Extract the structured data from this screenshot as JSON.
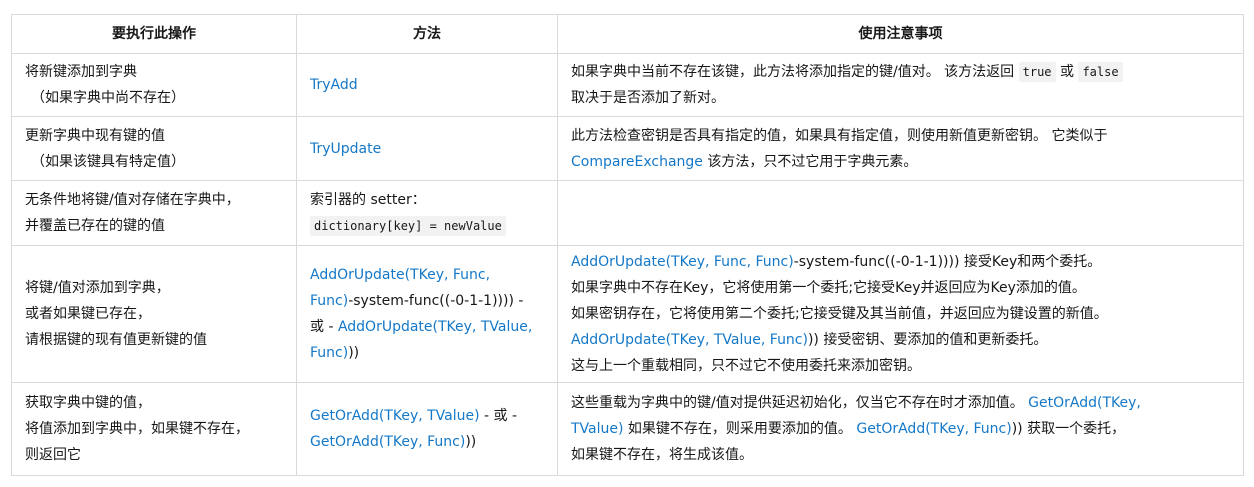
{
  "table": {
    "headers": [
      "要执行此操作",
      "方法",
      "使用注意事项"
    ],
    "rows": [
      {
        "action": [
          "将新键添加到字典",
          "（如果字典中尚不存在）"
        ],
        "method": {
          "link": "TryAdd"
        },
        "notes": {
          "t1": "如果字典中当前不存在该键，此方法将添加指定的键/值对。 该方法返回 ",
          "c1": "true",
          "t2": " 或 ",
          "c2": "false",
          "t3": "取决于是否添加了新对。"
        }
      },
      {
        "action": [
          "更新字典中现有键的值",
          "（如果该键具有特定值）"
        ],
        "method": {
          "link": "TryUpdate"
        },
        "notes": {
          "t1": "此方法检查密钥是否具有指定的值，如果具有指定值，则使用新值更新密钥。 它类似于",
          "link": "CompareExchange",
          "t2": " 该方法，只不过它用于字典元素。"
        }
      },
      {
        "action": [
          "无条件地将键/值对存储在字典中，",
          "并覆盖已存在的键的值"
        ],
        "method": {
          "text": "索引器的 setter：",
          "code": "dictionary[key] = newValue"
        },
        "notes": {}
      },
      {
        "action": [
          "将键/值对添加到字典，",
          "或者如果键已存在，",
          "请根据键的现有值更新键的值"
        ],
        "method": {
          "link1a": "AddOrUpdate(TKey, Func,",
          "link1b": "Func)",
          "text1": "-system-func((-0-1-1)))) -",
          "text2": "或 - ",
          "link2a": "AddOrUpdate(TKey, TValue,",
          "link2b": "Func)",
          "text3": "))"
        },
        "notes": {
          "l1_link": "AddOrUpdate(TKey, Func, Func)",
          "l1_text": "-system-func((-0-1-1)))) 接受Key和两个委托。",
          "l2": "如果字典中不存在Key，它将使用第一个委托;它接受Key并返回应为Key添加的值。",
          "l3": "如果密钥存在，它将使用第二个委托;它接受键及其当前值，并返回应为键设置的新值。",
          "l4_link": "AddOrUpdate(TKey, TValue, Func)",
          "l4_text": ")) 接受密钥、要添加的值和更新委托。",
          "l5": "这与上一个重载相同，只不过它不使用委托来添加密钥。"
        }
      },
      {
        "action": [
          "获取字典中键的值，",
          "将值添加到字典中，如果键不存在，",
          "则返回它"
        ],
        "method": {
          "link1": "GetOrAdd(TKey, TValue)",
          "text1": " - 或 -",
          "link2": "GetOrAdd(TKey, Func)",
          "text2": "))"
        },
        "notes": {
          "t1": "这些重载为字典中的键/值对提供延迟初始化，仅当它不存在时才添加值。 ",
          "link1a": "GetOrAdd(TKey,",
          "link1b": "TValue)",
          "t2": " 如果键不存在，则采用要添加的值。 ",
          "link2": "GetOrAdd(TKey, Func)",
          "t3": ")) 获取一个委托，",
          "t4": "如果键不存在，将生成该值。"
        }
      }
    ]
  },
  "colors": {
    "link": "#1478c8",
    "border": "#d9d9d9",
    "code_bg": "#f2f2f2",
    "text": "#171717"
  }
}
